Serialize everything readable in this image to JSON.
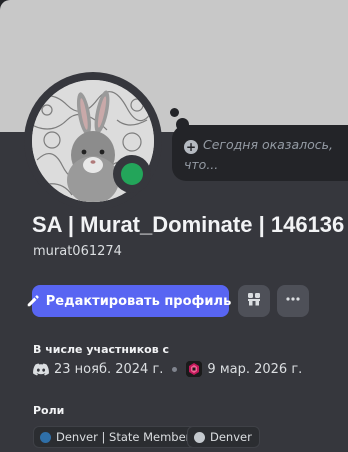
{
  "profile": {
    "display_name": "SA | Murat_Dominate | 146136",
    "username": "murat061274",
    "status": "online"
  },
  "note": {
    "placeholder": "Сегодня оказалось, что..."
  },
  "actions": {
    "edit_profile_label": "Редактировать профиль"
  },
  "membership": {
    "label": "В числе участников с",
    "discord_since": "23 нояб. 2024 г.",
    "server_since": "9 мар. 2026 г."
  },
  "roles": {
    "label": "Роли",
    "items": [
      {
        "name": "Denver | State Member",
        "color": "#2f6fa8"
      },
      {
        "name": "Denver",
        "color": "#c4c9ce"
      }
    ]
  },
  "colors": {
    "accent": "#5865f2",
    "online": "#23a55a",
    "card_bg": "#36373d",
    "banner": "#c8c8c8"
  },
  "icons": {
    "edit": "pencil-icon",
    "nitro": "nitro-shop-icon",
    "more": "more-horizontal-icon",
    "discord": "discord-icon",
    "note_add": "plus-circle-icon"
  }
}
